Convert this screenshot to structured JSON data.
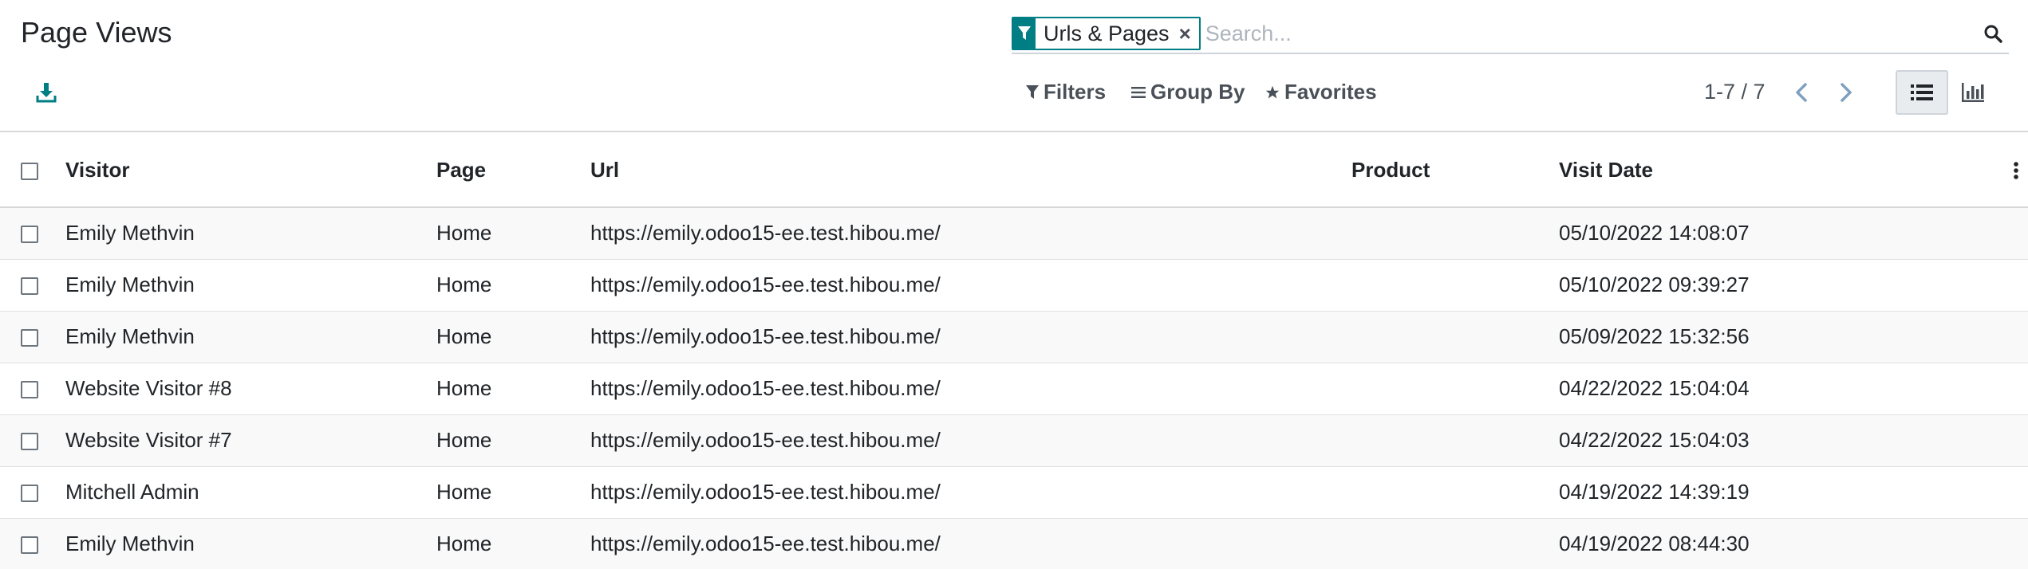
{
  "page": {
    "title": "Page Views"
  },
  "search": {
    "facet_label": "Urls & Pages",
    "facet_remove": "×",
    "placeholder": "Search..."
  },
  "filters": {
    "filters_label": "Filters",
    "group_by_label": "Group By",
    "favorites_label": "Favorites"
  },
  "pager": {
    "value": "1-7 / 7"
  },
  "icons": {
    "download": "download-icon",
    "filter": "filter-icon",
    "search": "search-icon",
    "group_by": "bars-icon",
    "favorites": "star-icon",
    "prev": "chevron-left-icon",
    "next": "chevron-right-icon",
    "list_view": "list-icon",
    "graph_view": "bar-chart-icon",
    "optional_columns": "vertical-ellipsis-icon"
  },
  "colors": {
    "accent": "#017e84"
  },
  "table": {
    "columns": [
      "Visitor",
      "Page",
      "Url",
      "Product",
      "Visit Date"
    ],
    "rows": [
      {
        "visitor": "Emily Methvin",
        "page": "Home",
        "url": "https://emily.odoo15-ee.test.hibou.me/",
        "product": "",
        "visit_date": "05/10/2022 14:08:07"
      },
      {
        "visitor": "Emily Methvin",
        "page": "Home",
        "url": "https://emily.odoo15-ee.test.hibou.me/",
        "product": "",
        "visit_date": "05/10/2022 09:39:27"
      },
      {
        "visitor": "Emily Methvin",
        "page": "Home",
        "url": "https://emily.odoo15-ee.test.hibou.me/",
        "product": "",
        "visit_date": "05/09/2022 15:32:56"
      },
      {
        "visitor": "Website Visitor #8",
        "page": "Home",
        "url": "https://emily.odoo15-ee.test.hibou.me/",
        "product": "",
        "visit_date": "04/22/2022 15:04:04"
      },
      {
        "visitor": "Website Visitor #7",
        "page": "Home",
        "url": "https://emily.odoo15-ee.test.hibou.me/",
        "product": "",
        "visit_date": "04/22/2022 15:04:03"
      },
      {
        "visitor": "Mitchell Admin",
        "page": "Home",
        "url": "https://emily.odoo15-ee.test.hibou.me/",
        "product": "",
        "visit_date": "04/19/2022 14:39:19"
      },
      {
        "visitor": "Emily Methvin",
        "page": "Home",
        "url": "https://emily.odoo15-ee.test.hibou.me/",
        "product": "",
        "visit_date": "04/19/2022 08:44:30"
      }
    ]
  }
}
